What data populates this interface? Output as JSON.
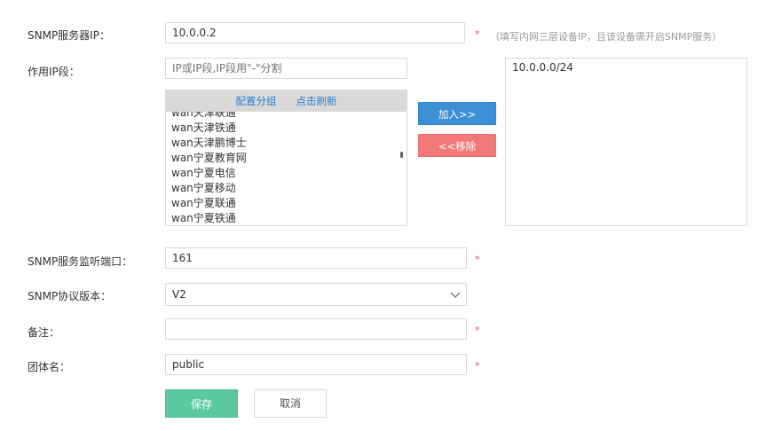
{
  "form": {
    "snmp_ip": {
      "label": "SNMP服务器IP：",
      "value": "10.0.0.2",
      "required_mark": "*",
      "hint": "（填写内网三层设备IP，且该设备需开启SNMP服务）"
    },
    "ip_range": {
      "label": "作用IP段：",
      "placeholder": "IP或IP段,IP段用\"-\"分割",
      "panel_links": [
        "配置分组",
        "点击刷新"
      ],
      "items": [
        "wan天津联通",
        "wan天津铁通",
        "wan天津鹏博士",
        "wan宁夏教育网",
        "wan宁夏电信",
        "wan宁夏移动",
        "wan宁夏联通",
        "wan宁夏铁通"
      ],
      "add_label": "加入>>",
      "remove_label": "<<移除",
      "selected": [
        "10.0.0.0/24"
      ]
    },
    "port": {
      "label": "SNMP服务监听端口：",
      "value": "161",
      "required_mark": "*"
    },
    "version": {
      "label": "SNMP协议版本：",
      "value": "V2"
    },
    "remark": {
      "label": "备注：",
      "value": "",
      "required_mark": "*"
    },
    "community": {
      "label": "团体名：",
      "value": "public",
      "required_mark": "*"
    }
  },
  "actions": {
    "save_label": "保存",
    "cancel_label": "取消"
  },
  "colors": {
    "add_button": "#3d8fd6",
    "remove_button": "#f2787a",
    "save_button": "#5bc9a0",
    "required": "#e05a5a",
    "link": "#2a7fd0"
  }
}
